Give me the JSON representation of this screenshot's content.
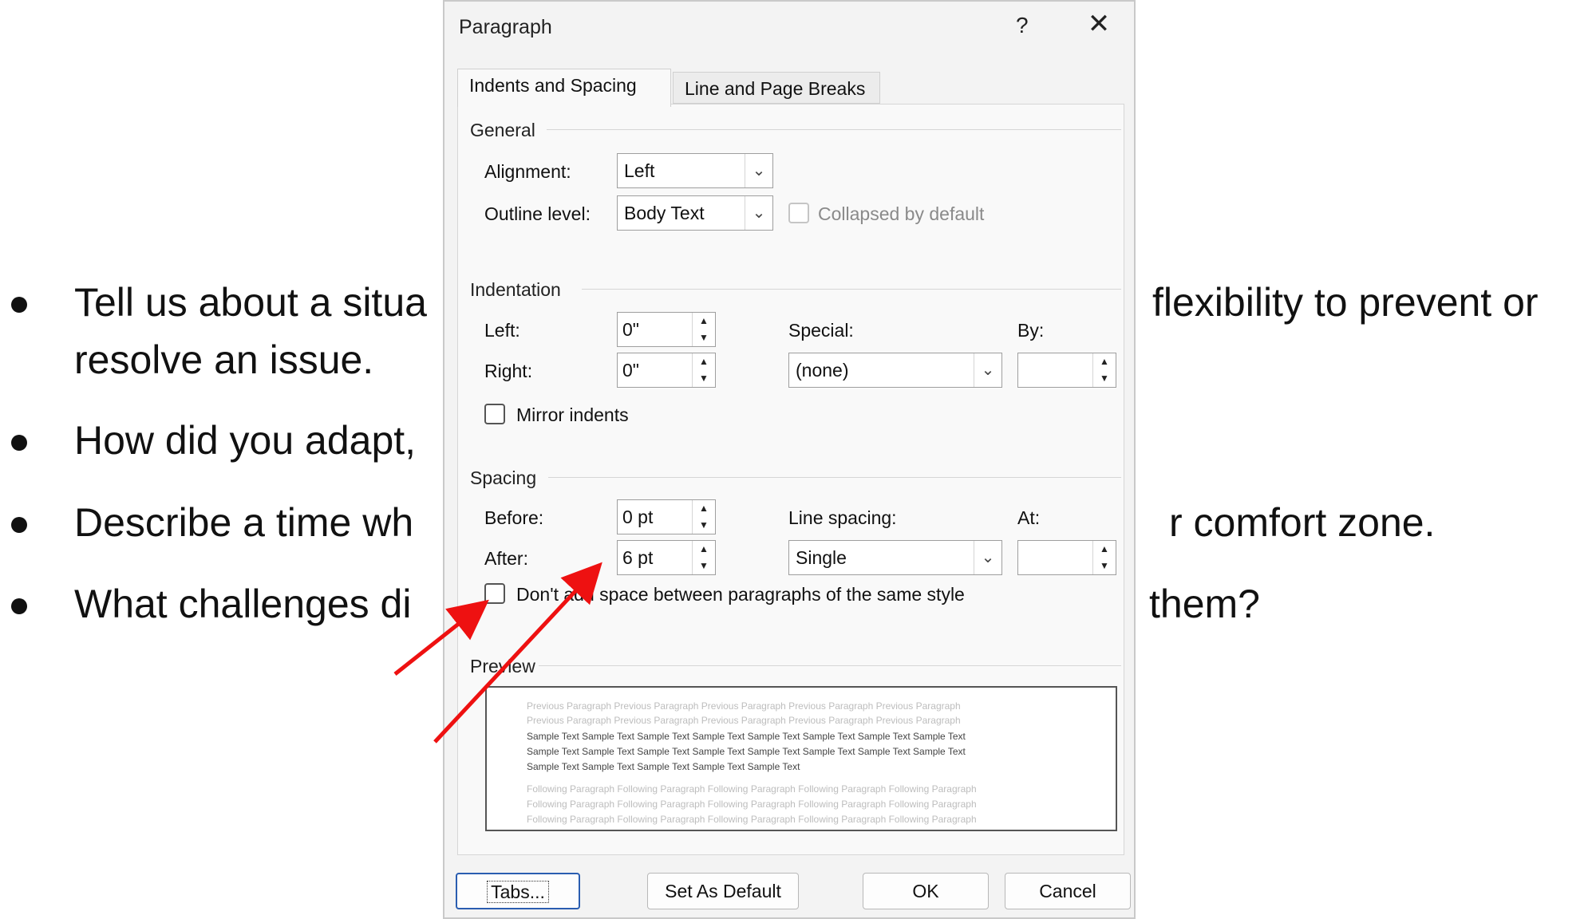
{
  "document": {
    "bullets": [
      {
        "left": "Tell us about a situa",
        "right": "flexibility to prevent or"
      },
      {
        "left": "resolve an issue.",
        "right": ""
      },
      {
        "left": "How did you adapt,",
        "right": ""
      },
      {
        "left": "Describe a time wh",
        "right": "r comfort zone."
      },
      {
        "left": "What challenges di",
        "right": "them?"
      }
    ]
  },
  "dialog": {
    "title": "Paragraph",
    "help": "?",
    "close": "✕",
    "tabs": [
      "Indents and Spacing",
      "Line and Page Breaks"
    ],
    "general": {
      "heading": "General",
      "alignment_label": "Alignment:",
      "alignment_value": "Left",
      "outline_label": "Outline level:",
      "outline_value": "Body Text",
      "collapsed_label": "Collapsed by default"
    },
    "indentation": {
      "heading": "Indentation",
      "left_label": "Left:",
      "left_value": "0\"",
      "right_label": "Right:",
      "right_value": "0\"",
      "special_label": "Special:",
      "special_value": "(none)",
      "by_label": "By:",
      "by_value": "",
      "mirror_label": "Mirror indents"
    },
    "spacing": {
      "heading": "Spacing",
      "before_label": "Before:",
      "before_value": "0 pt",
      "after_label": "After:",
      "after_value": "6 pt",
      "line_spacing_label": "Line spacing:",
      "line_spacing_value": "Single",
      "at_label": "At:",
      "at_value": "",
      "dont_add_label": "Don't add space between paragraphs of the same style"
    },
    "preview": {
      "heading": "Preview",
      "previous": [
        "Previous Paragraph Previous Paragraph Previous Paragraph Previous Paragraph Previous Paragraph",
        "Previous Paragraph Previous Paragraph Previous Paragraph Previous Paragraph Previous Paragraph"
      ],
      "sample": [
        "Sample Text Sample Text Sample Text Sample Text Sample Text Sample Text Sample Text Sample Text",
        "Sample Text Sample Text Sample Text Sample Text Sample Text Sample Text Sample Text Sample Text",
        "Sample Text Sample Text Sample Text Sample Text Sample Text"
      ],
      "following": [
        "Following Paragraph Following Paragraph Following Paragraph Following Paragraph Following Paragraph",
        "Following Paragraph Following Paragraph Following Paragraph Following Paragraph Following Paragraph",
        "Following Paragraph Following Paragraph Following Paragraph Following Paragraph Following Paragraph"
      ]
    },
    "buttons": {
      "tabs": "Tabs...",
      "set_default": "Set As Default",
      "ok": "OK",
      "cancel": "Cancel"
    }
  },
  "annotation": {
    "arrow_color": "#ee1111"
  }
}
